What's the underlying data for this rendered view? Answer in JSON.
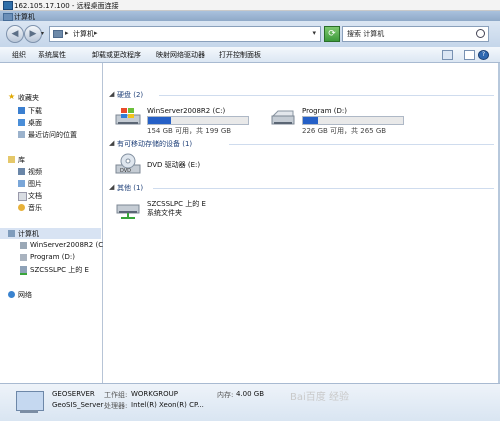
{
  "rdp": {
    "title": "162.105.17.100 - 远程桌面连接"
  },
  "window": {
    "title": "计算机"
  },
  "nav": {
    "address": "计算机",
    "search_placeholder": "搜索 计算机"
  },
  "toolbar": {
    "items": [
      "组织",
      "系统属性",
      "卸载或更改程序",
      "映射网络驱动器",
      "打开控制面板"
    ]
  },
  "sidebar": {
    "favorites": {
      "label": "收藏夹",
      "items": [
        "下载",
        "桌面",
        "最近访问的位置"
      ]
    },
    "library": {
      "label": "库",
      "items": [
        "视频",
        "图片",
        "文档",
        "音乐"
      ]
    },
    "computer": {
      "label": "计算机",
      "items": [
        "WinServer2008R2 (C",
        "Program (D:)",
        "SZCSSLPC 上的 E"
      ]
    },
    "network": {
      "label": "网络"
    }
  },
  "groups": {
    "hdd": {
      "title": "硬盘",
      "count": "(2)"
    },
    "removable": {
      "title": "有可移动存储的设备",
      "count": "(1)"
    },
    "other": {
      "title": "其他",
      "count": "(1)"
    }
  },
  "drives": [
    {
      "name": "WinServer2008R2 (C:)",
      "free_text": "154 GB 可用，共 199 GB",
      "used_fraction": 0.23
    },
    {
      "name": "Program (D:)",
      "free_text": "226 GB 可用，共 265 GB",
      "used_fraction": 0.15
    }
  ],
  "dvd": {
    "name": "DVD 驱动器 (E:)"
  },
  "share": {
    "name": "SZCSSLPC 上的 E",
    "type": "系统文件夹"
  },
  "status": {
    "name": "GEOSERVER",
    "workgroup_label": "工作组:",
    "workgroup": "WORKGROUP",
    "memory_label": "内存:",
    "memory": "4.00 GB",
    "user": "GeoSIS_Server",
    "cpu_label": "处理器:",
    "cpu": "Intel(R) Xeon(R) CP..."
  },
  "watermark": "Bai百度 经验",
  "colors": {
    "accent": "#2560c7",
    "group_title": "#1e3f78",
    "selection": "#d8e3f3"
  }
}
